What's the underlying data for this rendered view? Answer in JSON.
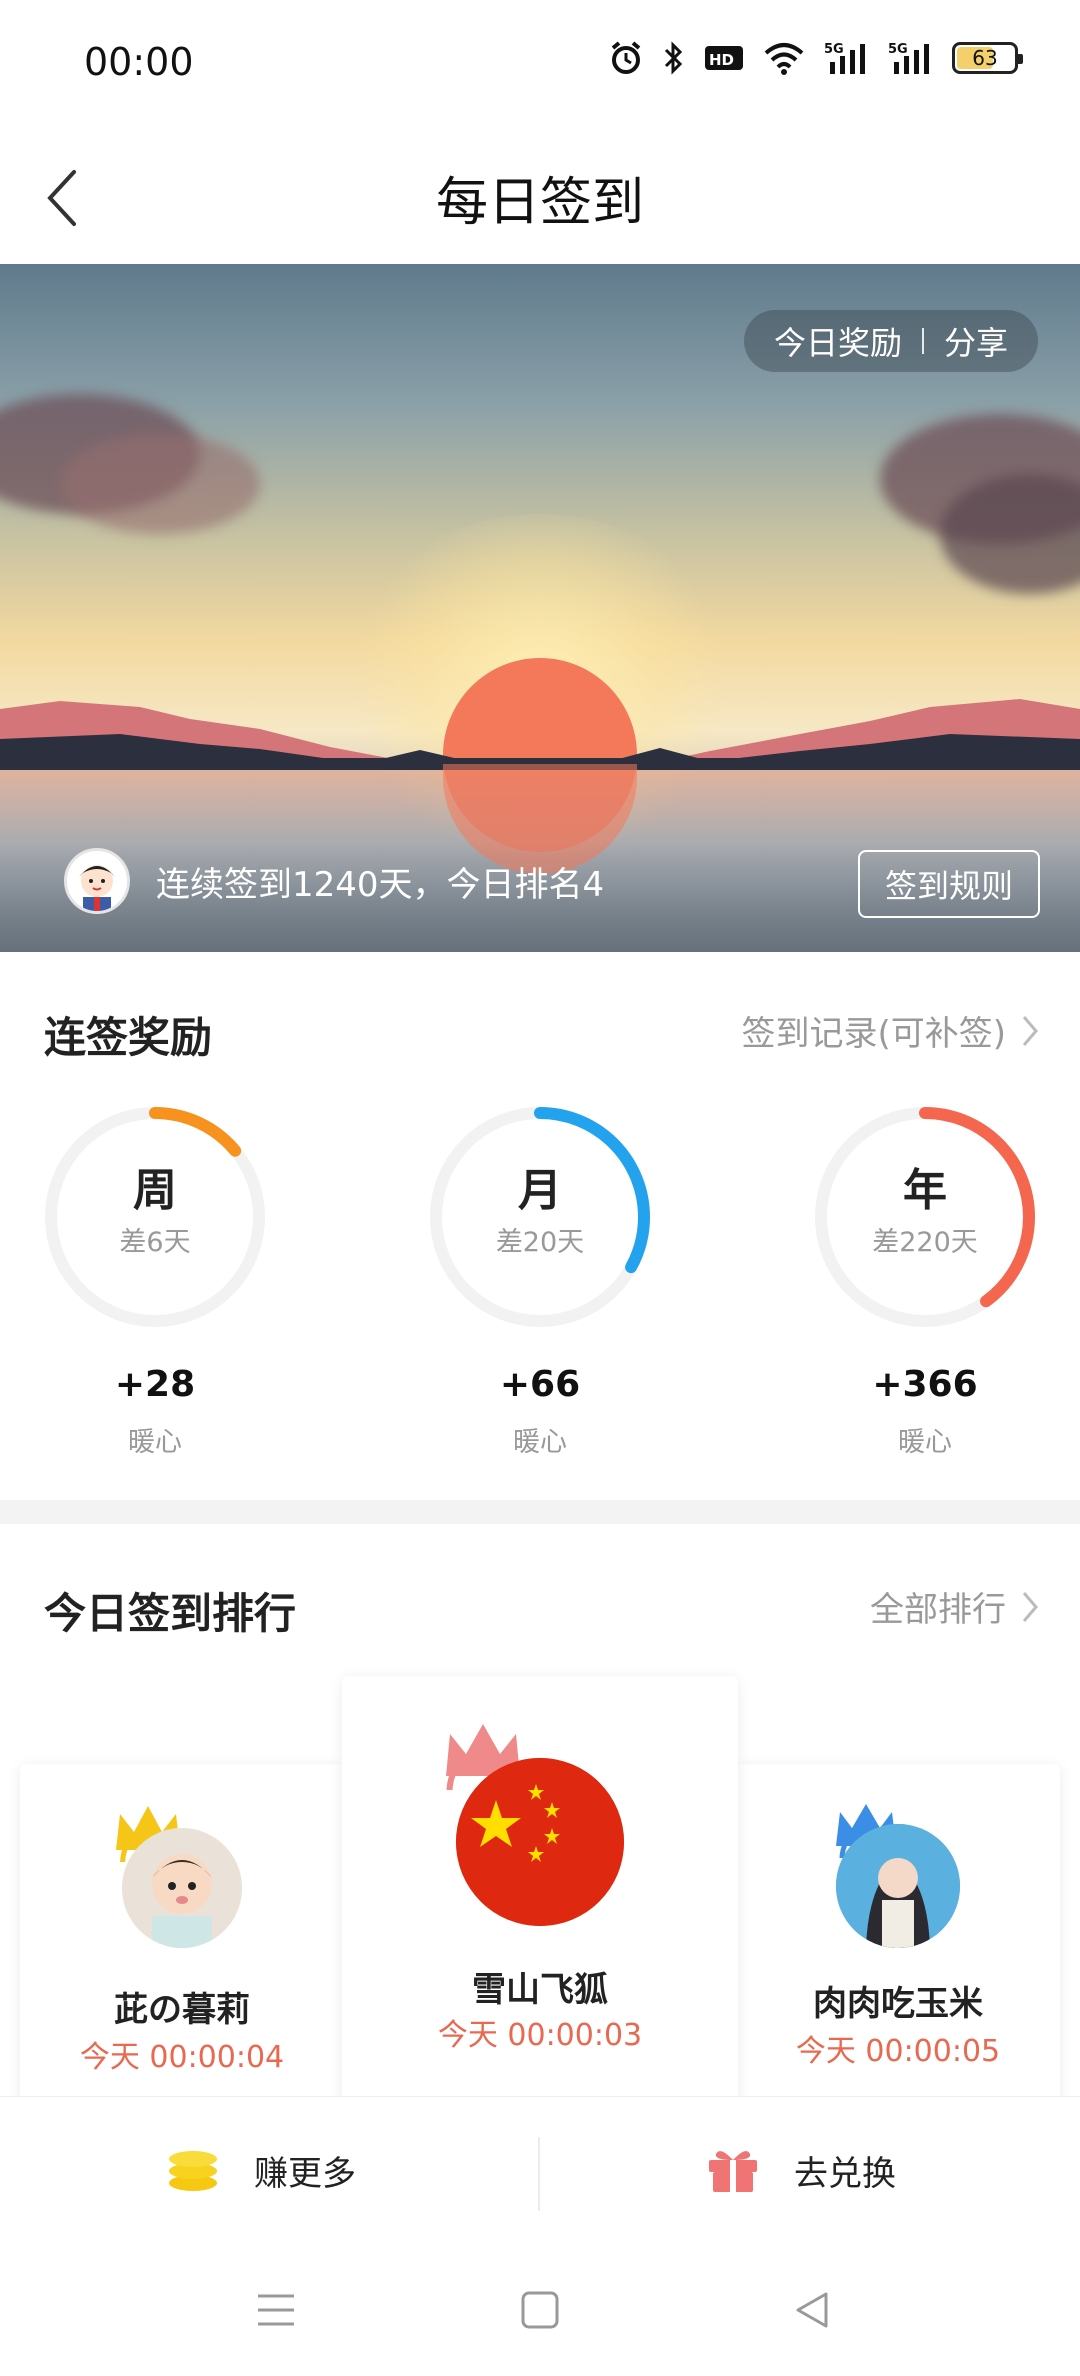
{
  "status_bar": {
    "time": "00:00",
    "battery_level": "63",
    "icons": [
      "alarm-icon",
      "bluetooth-icon",
      "hd-icon",
      "wifi-icon",
      "5g-signal-icon",
      "5g-signal-icon",
      "battery-icon"
    ]
  },
  "header": {
    "title": "每日签到",
    "back_icon": "chevron-left-icon"
  },
  "hero": {
    "today_reward": "今日奖励",
    "share": "分享",
    "streak_text": "连续签到1240天，今日排名4",
    "rules_button": "签到规则"
  },
  "rewards": {
    "title": "连签奖励",
    "record_link": "签到记录(可补签)",
    "items": [
      {
        "period": "周",
        "remaining": "差6天",
        "points": "+28",
        "unit": "暖心",
        "progress": 0.14,
        "color": "#f7921e"
      },
      {
        "period": "月",
        "remaining": "差20天",
        "points": "+66",
        "unit": "暖心",
        "progress": 0.33,
        "color": "#23a3ee"
      },
      {
        "period": "年",
        "remaining": "差220天",
        "points": "+366",
        "unit": "暖心",
        "progress": 0.4,
        "color": "#f4674e"
      }
    ]
  },
  "ranking": {
    "title": "今日签到排行",
    "all_link": "全部排行",
    "entries": [
      {
        "name": "茈の暮莉",
        "time": "今天 00:00:04",
        "crown_color": "#f5c518"
      },
      {
        "name": "雪山飞狐",
        "time": "今天 00:00:03",
        "crown_color": "#f08a8a"
      },
      {
        "name": "肉肉吃玉米",
        "time": "今天 00:00:05",
        "crown_color": "#3a8ee6"
      }
    ]
  },
  "actions": {
    "earn_more": "赚更多",
    "redeem": "去兑换"
  },
  "colors": {
    "accent_red": "#e8694f",
    "coin_yellow": "#f7d21e",
    "gift_red": "#f07474"
  }
}
